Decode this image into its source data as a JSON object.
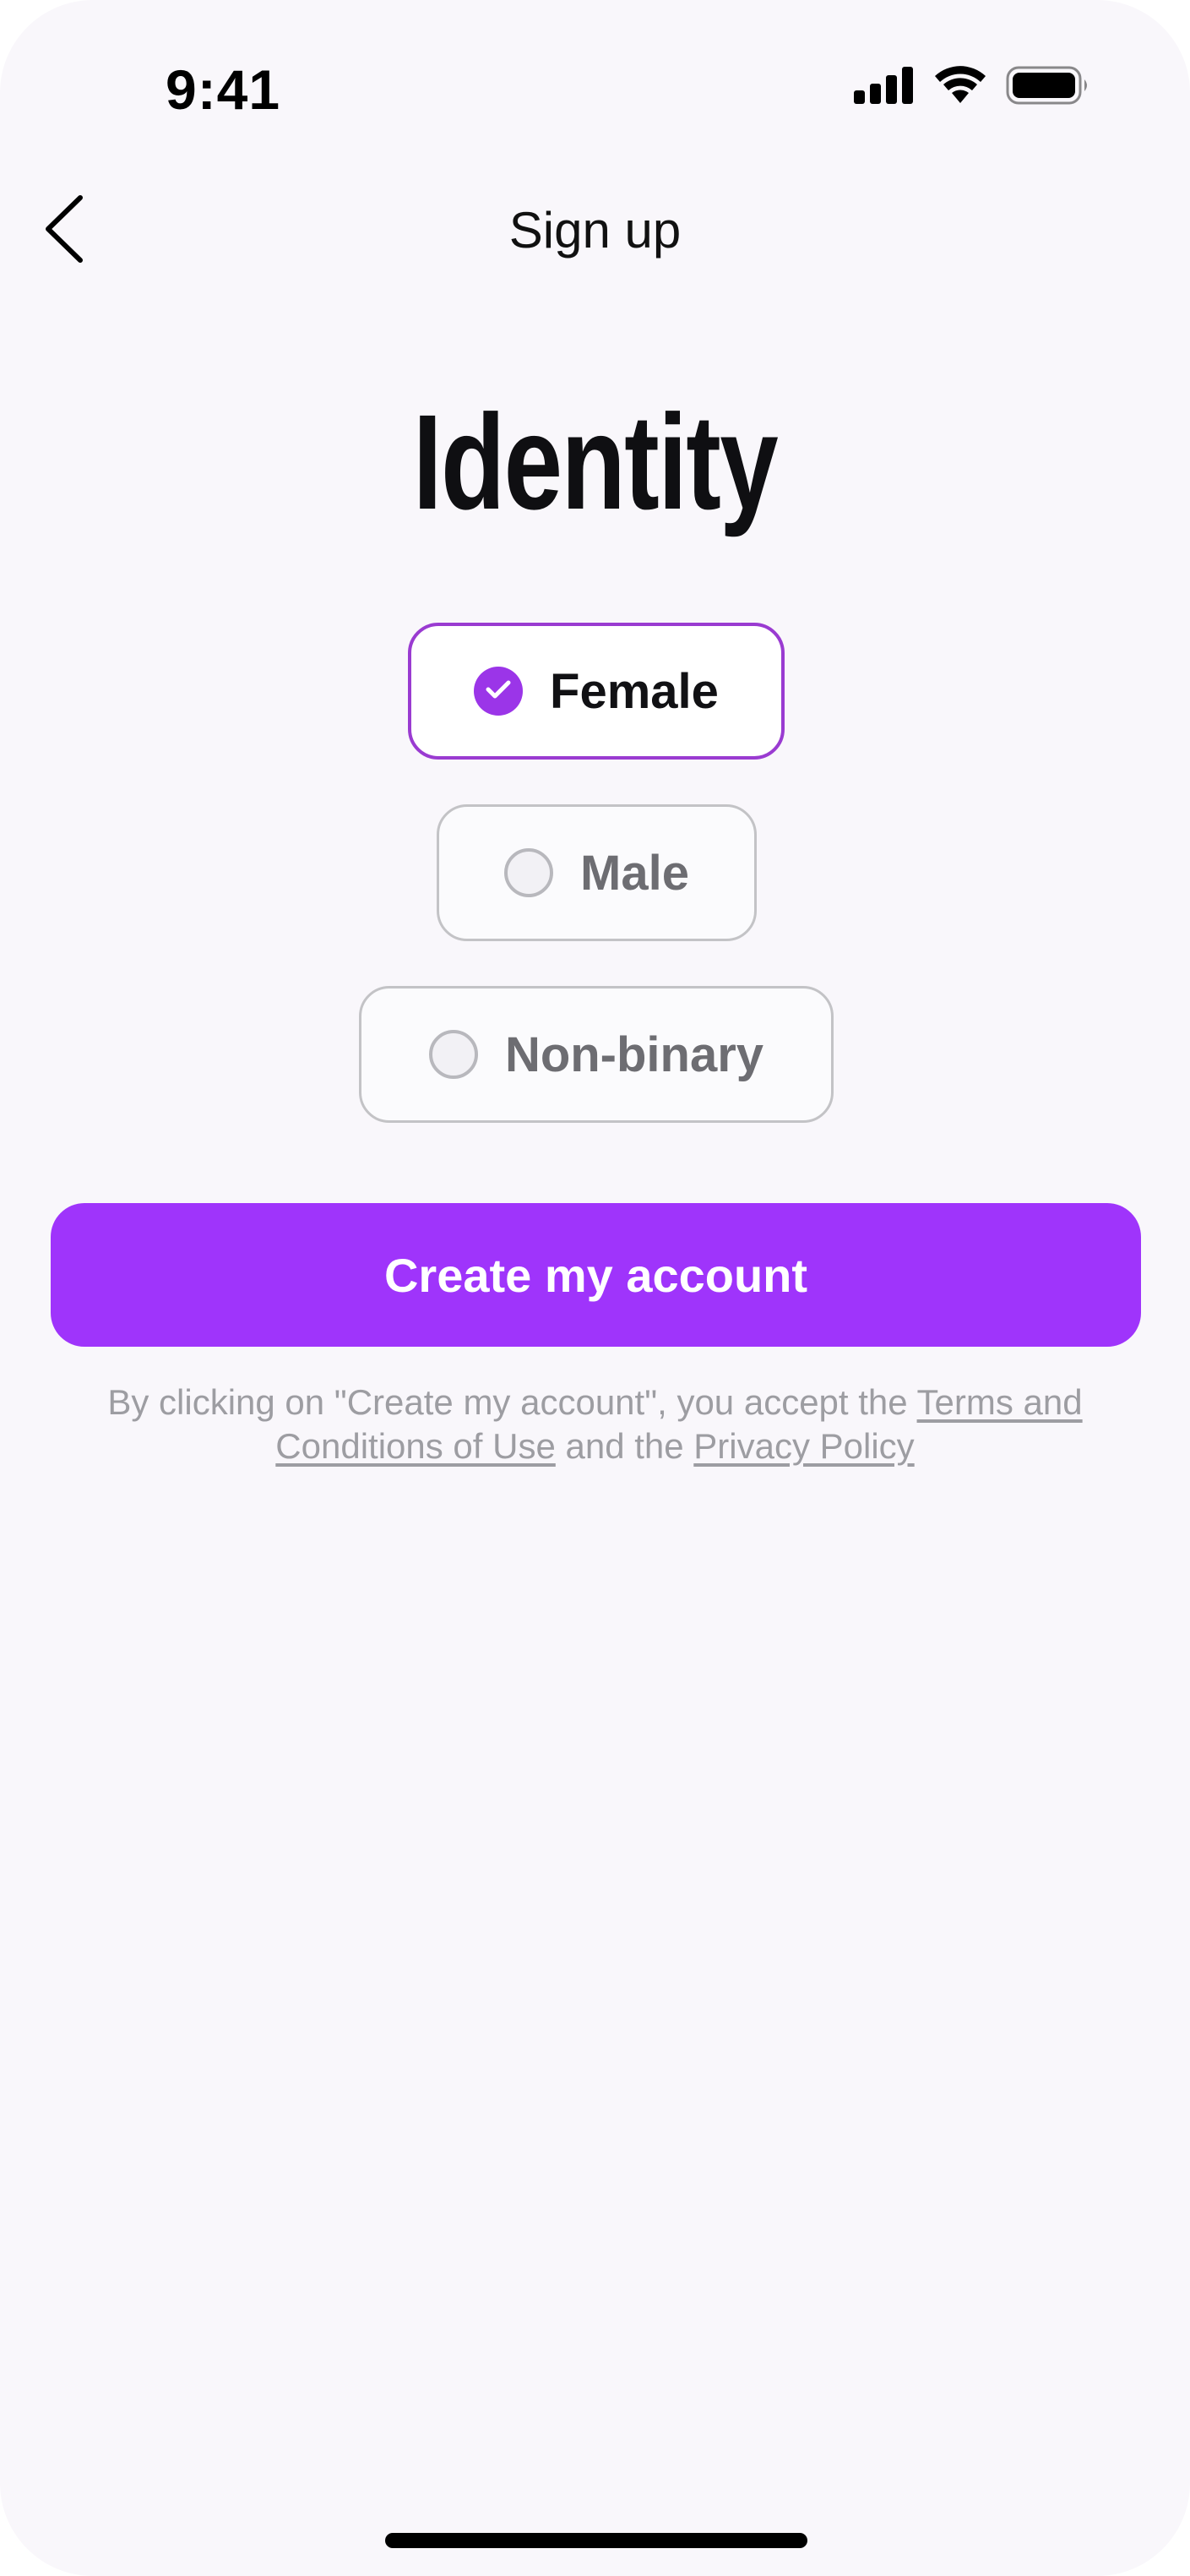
{
  "status_bar": {
    "time": "9:41",
    "icons": [
      "cellular-signal-icon",
      "wifi-icon",
      "battery-icon"
    ]
  },
  "nav": {
    "back_icon": "chevron-left-icon",
    "title": "Sign up"
  },
  "heading": "Identity",
  "options": [
    {
      "label": "Female",
      "selected": true
    },
    {
      "label": "Male",
      "selected": false
    },
    {
      "label": "Non-binary",
      "selected": false
    }
  ],
  "cta": {
    "label": "Create my account"
  },
  "legal": {
    "prefix": "By clicking on \"Create my account\", you accept the ",
    "terms_link": "Terms and Conditions of Use",
    "middle": " and the ",
    "privacy_link": "Privacy Policy"
  },
  "colors": {
    "accent": "#9F34FB",
    "selected_border": "#9A3BD1",
    "background": "#F9F7FB"
  }
}
